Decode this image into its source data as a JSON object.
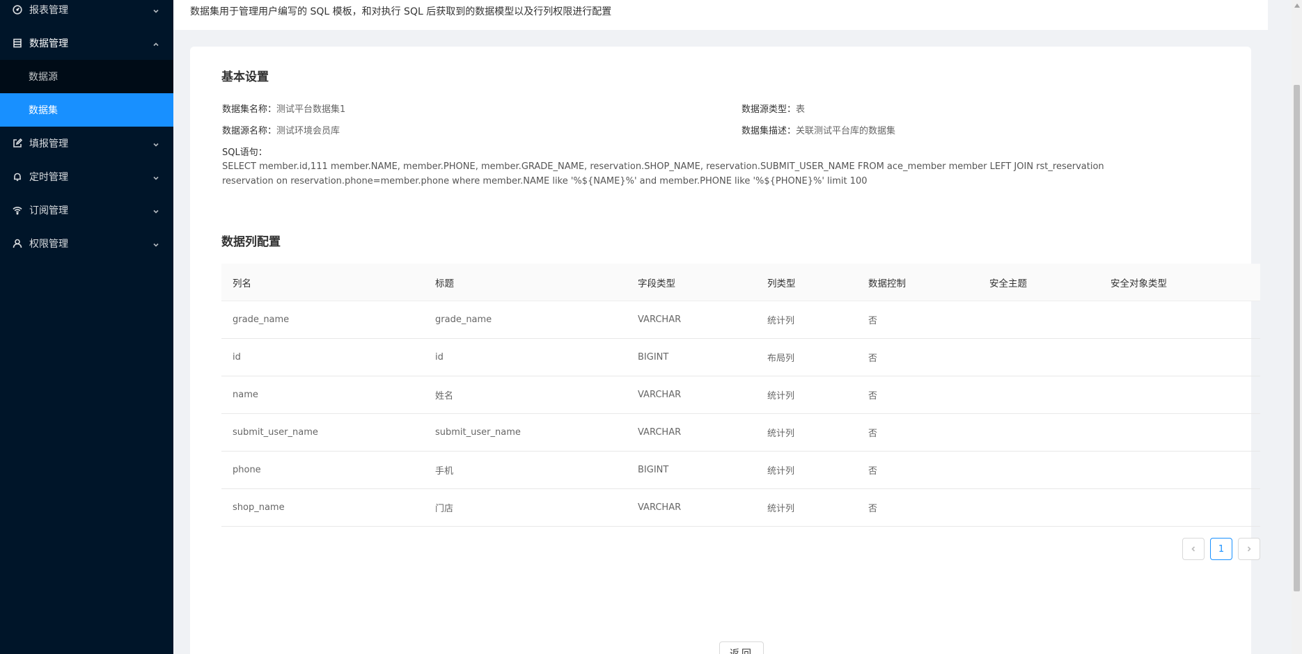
{
  "sidebar": {
    "items": [
      {
        "label": "报表管理",
        "icon": "dashboard-icon",
        "open": false
      },
      {
        "label": "数据管理",
        "icon": "database-icon",
        "open": true,
        "children": [
          {
            "label": "数据源",
            "active": false
          },
          {
            "label": "数据集",
            "active": true
          }
        ]
      },
      {
        "label": "填报管理",
        "icon": "edit-icon",
        "open": false
      },
      {
        "label": "定时管理",
        "icon": "bell-icon",
        "open": false
      },
      {
        "label": "订阅管理",
        "icon": "wifi-icon",
        "open": false
      },
      {
        "label": "权限管理",
        "icon": "user-icon",
        "open": false
      }
    ]
  },
  "header": {
    "description": "数据集用于管理用户编写的 SQL 模板，和对执行 SQL 后获取到的数据模型以及行列权限进行配置"
  },
  "basic": {
    "title": "基本设置",
    "dataset_name_label": "数据集名称：",
    "dataset_name": "测试平台数据集1",
    "source_type_label": "数据源类型：",
    "source_type": "表",
    "source_name_label": "数据源名称：",
    "source_name": "测试环境会员库",
    "dataset_desc_label": "数据集描述：",
    "dataset_desc": "关联测试平台库的数据集",
    "sql_label": "SQL语句：",
    "sql": "SELECT member.id,111 member.NAME, member.PHONE, member.GRADE_NAME, reservation.SHOP_NAME, reservation.SUBMIT_USER_NAME FROM ace_member member LEFT JOIN rst_reservation reservation on reservation.phone=member.phone where member.NAME like '%${NAME}%' and member.PHONE like '%${PHONE}%' limit 100"
  },
  "columns": {
    "title": "数据列配置",
    "headers": [
      "列名",
      "标题",
      "字段类型",
      "列类型",
      "数据控制",
      "安全主题",
      "安全对象类型"
    ],
    "rows": [
      [
        "grade_name",
        "grade_name",
        "VARCHAR",
        "统计列",
        "否",
        "",
        ""
      ],
      [
        "id",
        "id",
        "BIGINT",
        "布局列",
        "否",
        "",
        ""
      ],
      [
        "name",
        "姓名",
        "VARCHAR",
        "统计列",
        "否",
        "",
        ""
      ],
      [
        "submit_user_name",
        "submit_user_name",
        "VARCHAR",
        "统计列",
        "否",
        "",
        ""
      ],
      [
        "phone",
        "手机",
        "BIGINT",
        "统计列",
        "否",
        "",
        ""
      ],
      [
        "shop_name",
        "门店",
        "VARCHAR",
        "统计列",
        "否",
        "",
        ""
      ]
    ]
  },
  "pagination": {
    "current": "1"
  },
  "footer": {
    "back_label": "返回"
  },
  "colors": {
    "sidebar_bg": "#001529",
    "accent": "#1890ff"
  }
}
